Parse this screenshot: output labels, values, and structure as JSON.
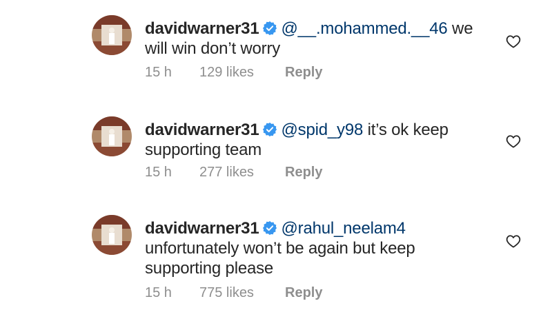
{
  "comments": [
    {
      "username": "davidwarner31",
      "mention": "@__.mohammed.__46",
      "text_line1": " we",
      "text_line2": "will win don’t worry",
      "time": "15 h",
      "likes": "129 likes",
      "reply": "Reply"
    },
    {
      "username": "davidwarner31",
      "mention": "@spid_y98",
      "text_line1": " it’s ok keep",
      "text_line2": "supporting team",
      "time": "15 h",
      "likes": "277 likes",
      "reply": "Reply"
    },
    {
      "username": "davidwarner31",
      "mention": "@rahul_neelam4",
      "text_line1": "",
      "text_line2": "unfortunately won’t be again but keep",
      "text_line3": "supporting please",
      "time": "15 h",
      "likes": "775 likes",
      "reply": "Reply"
    }
  ],
  "icons": {
    "verified": "verified-badge-icon",
    "like": "heart-outline-icon",
    "avatar": "profile-avatar"
  },
  "colors": {
    "verified_blue": "#3897f0",
    "text": "#262626",
    "meta_gray": "#8e8e8e",
    "mention": "#00376b"
  }
}
